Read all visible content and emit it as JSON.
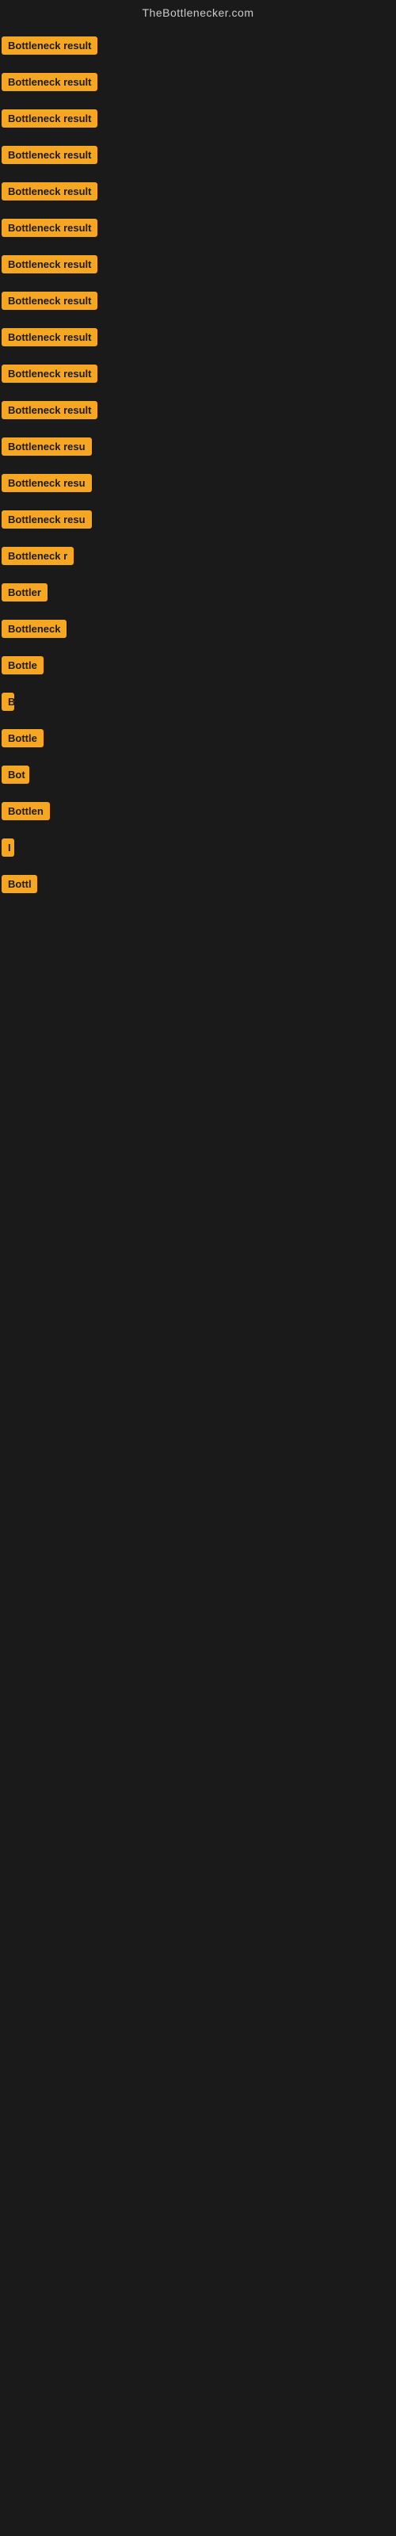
{
  "header": {
    "title": "TheBottlenecker.com"
  },
  "items": [
    {
      "label": "Bottleneck result",
      "width": 164
    },
    {
      "label": "Bottleneck result",
      "width": 156
    },
    {
      "label": "Bottleneck result",
      "width": 159
    },
    {
      "label": "Bottleneck result",
      "width": 156
    },
    {
      "label": "Bottleneck result",
      "width": 155
    },
    {
      "label": "Bottleneck result",
      "width": 155
    },
    {
      "label": "Bottleneck result",
      "width": 155
    },
    {
      "label": "Bottleneck result",
      "width": 151
    },
    {
      "label": "Bottleneck result",
      "width": 151
    },
    {
      "label": "Bottleneck result",
      "width": 151
    },
    {
      "label": "Bottleneck result",
      "width": 151
    },
    {
      "label": "Bottleneck resu",
      "width": 130
    },
    {
      "label": "Bottleneck resu",
      "width": 125
    },
    {
      "label": "Bottleneck resu",
      "width": 120
    },
    {
      "label": "Bottleneck r",
      "width": 95
    },
    {
      "label": "Bottler",
      "width": 60
    },
    {
      "label": "Bottleneck",
      "width": 85
    },
    {
      "label": "Bottle",
      "width": 55
    },
    {
      "label": "B",
      "width": 16
    },
    {
      "label": "Bottle",
      "width": 55
    },
    {
      "label": "Bot",
      "width": 35
    },
    {
      "label": "Bottlen",
      "width": 65
    },
    {
      "label": "I",
      "width": 8
    },
    {
      "label": "Bottl",
      "width": 45
    }
  ],
  "colors": {
    "badge_bg": "#f5a623",
    "badge_text": "#1a1a1a",
    "page_bg": "#1a1a1a",
    "header_text": "#cccccc"
  }
}
